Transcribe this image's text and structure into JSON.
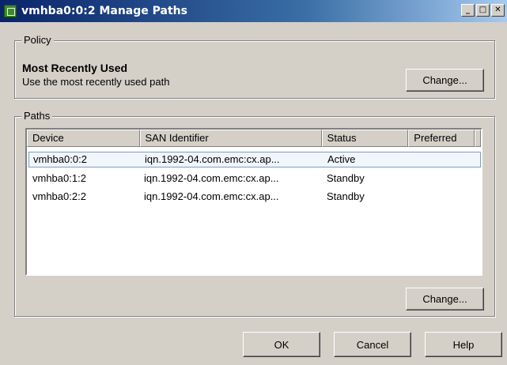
{
  "window": {
    "title": "vmhba0:0:2 Manage Paths",
    "controls": {
      "minimize": "_",
      "maximize": "□",
      "close": "✕"
    }
  },
  "policy": {
    "group_label": "Policy",
    "name": "Most Recently Used",
    "description": "Use the most recently used path",
    "change_label": "Change..."
  },
  "paths": {
    "group_label": "Paths",
    "columns": [
      "Device",
      "SAN Identifier",
      "Status",
      "Preferred"
    ],
    "rows": [
      {
        "device": "vmhba0:0:2",
        "san": "iqn.1992-04.com.emc:cx.ap...",
        "status": "Active",
        "preferred": ""
      },
      {
        "device": "vmhba0:1:2",
        "san": "iqn.1992-04.com.emc:cx.ap...",
        "status": "Standby",
        "preferred": ""
      },
      {
        "device": "vmhba0:2:2",
        "san": "iqn.1992-04.com.emc:cx.ap...",
        "status": "Standby",
        "preferred": ""
      }
    ],
    "selected_row": 0,
    "change_label": "Change..."
  },
  "footer": {
    "ok_label": "OK",
    "cancel_label": "Cancel",
    "help_label": "Help"
  },
  "colors": {
    "titlebar_start": "#0a246a",
    "titlebar_end": "#a6caf0",
    "dialog_bg": "#d4d0c8",
    "selection_border": "#7f9db9"
  },
  "icons": {
    "app": "vmware-app-icon"
  }
}
